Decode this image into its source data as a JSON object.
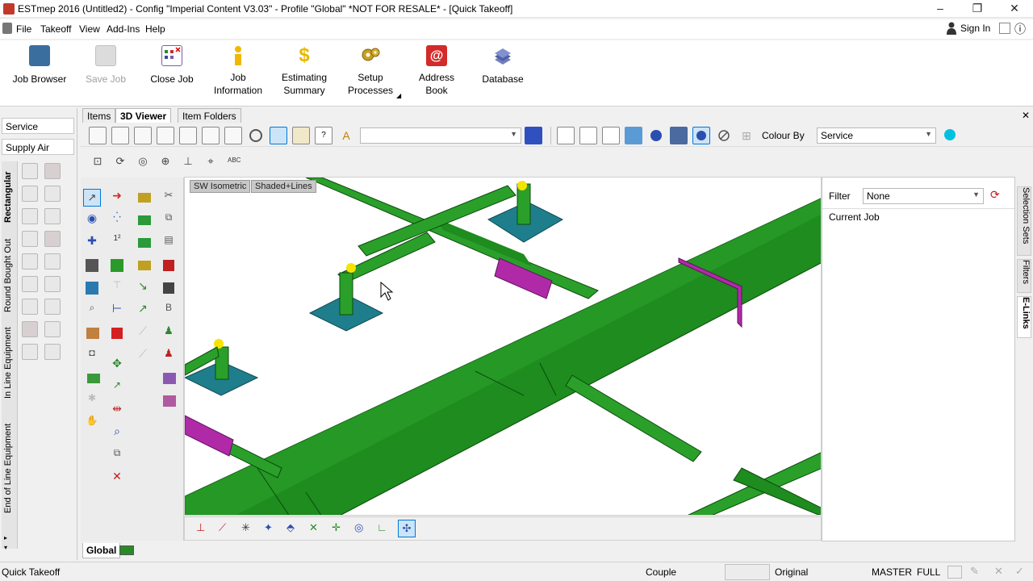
{
  "window": {
    "title": "ESTmep 2016 (Untitled2) - Config \"Imperial Content V3.03\" - Profile \"Global\" *NOT FOR RESALE* - [Quick Takeoff]",
    "minimize": "–",
    "restore": "❐",
    "close": "✕"
  },
  "menu": {
    "items": [
      "File",
      "Takeoff",
      "View",
      "Add-Ins",
      "Help"
    ],
    "sign_in": "Sign In",
    "info": "ⓘ"
  },
  "ribbon": {
    "buttons": [
      {
        "label1": "Job Browser",
        "label2": "",
        "icon": "job-browser-icon",
        "color": "#3a6e9e"
      },
      {
        "label1": "Save Job",
        "label2": "",
        "icon": "save-icon",
        "color": "#c8c8c8"
      },
      {
        "label1": "Close Job",
        "label2": "",
        "icon": "close-job-icon",
        "color": "#7a5ea8"
      },
      {
        "label1": "Job",
        "label2": "Information",
        "icon": "info-icon",
        "color": "#f0b800"
      },
      {
        "label1": "Estimating",
        "label2": "Summary",
        "icon": "dollar-icon",
        "color": "#e8b800"
      },
      {
        "label1": "Setup",
        "label2": "Processes",
        "icon": "gears-icon",
        "color": "#c8a020"
      },
      {
        "label1": "Address",
        "label2": "Book",
        "icon": "address-book-icon",
        "color": "#d42a2a"
      },
      {
        "label1": "Database",
        "label2": "",
        "icon": "database-icon",
        "color": "#5060a0"
      }
    ]
  },
  "left_panel": {
    "service": "Service",
    "service_type": "Supply Air",
    "vertical_tabs": [
      "Rectangular",
      "Round Bought Out",
      "In Line Equipment",
      "End of Line Equipment"
    ]
  },
  "view_tabs": [
    "Items",
    "3D Viewer",
    "Item Folders"
  ],
  "viewer_toolbar": {
    "view_combo": "",
    "colour_by_label": "Colour By",
    "colour_by_value": "Service",
    "row2_text": "ABC"
  },
  "viewport": {
    "view_label": "SW Isometric",
    "render_label": "Shaded+Lines"
  },
  "right_panel": {
    "filter_label": "Filter",
    "filter_value": "None",
    "tree_root": "Current Job",
    "vertical_tabs": [
      "Selection Sets",
      "Filters",
      "E-Links"
    ]
  },
  "bottom_tabs": [
    "Global"
  ],
  "status": {
    "mode": "Quick Takeoff",
    "couple": "Couple",
    "original": "Original",
    "master": "MASTER",
    "full": "FULL"
  },
  "colors": {
    "duct_green": "#1e8c1e",
    "flex_magenta": "#b02aa8",
    "diffuser_teal": "#1f7e8c",
    "accent_blue": "#0078d7"
  }
}
